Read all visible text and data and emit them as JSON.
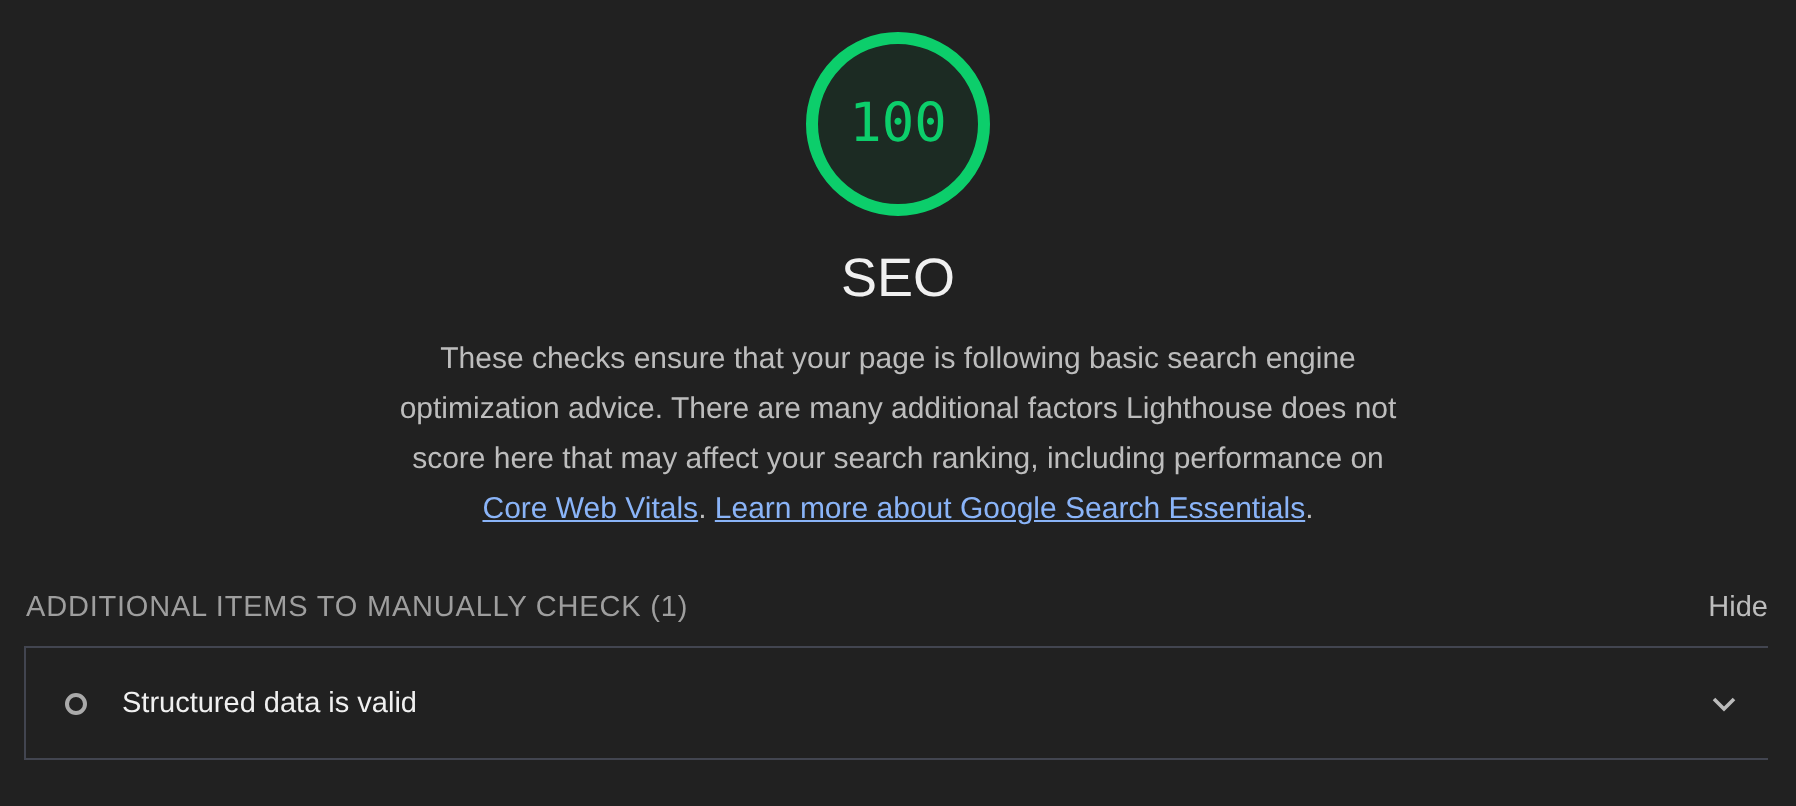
{
  "score": {
    "value": "100",
    "level": 1
  },
  "title": "SEO",
  "description": [
    {
      "kind": "text",
      "text": "These checks ensure that your page is following basic search engine optimization advice. There are many additional factors Lighthouse does not score here that may affect your search ranking, including performance on "
    },
    {
      "kind": "link",
      "text": "Core Web Vitals"
    },
    {
      "kind": "text",
      "text": ". "
    },
    {
      "kind": "link",
      "text": "Learn more about Google Search Essentials"
    },
    {
      "kind": "text",
      "text": "."
    }
  ],
  "group": {
    "title": "ADDITIONAL ITEMS TO MANUALLY CHECK",
    "count": "(1)",
    "toggle": "Hide"
  },
  "audits": [
    {
      "title": "Structured data is valid",
      "expanded": false
    }
  ]
}
